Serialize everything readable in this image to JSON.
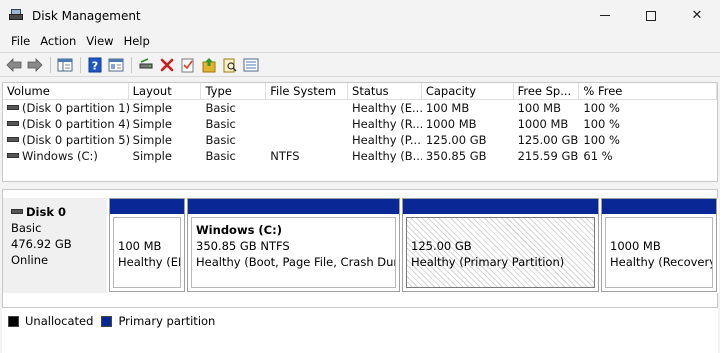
{
  "window": {
    "title": "Disk Management",
    "minimize": "—",
    "close": "✕"
  },
  "menu": [
    "File",
    "Action",
    "View",
    "Help"
  ],
  "toolbar": {
    "icons": [
      "back-arrow-icon",
      "forward-arrow-icon",
      "show-hide-console-tree-icon",
      "help-icon",
      "properties-icon",
      "connect-drive-icon",
      "delete-icon",
      "check-icon",
      "export-list-icon",
      "search-icon",
      "details-icon"
    ],
    "colors": {
      "delete": "#d11b1b",
      "help": "#1f57c6",
      "check": "#d8402a",
      "folder": "#e2b42a"
    }
  },
  "volumes": {
    "headers": [
      "Volume",
      "Layout",
      "Type",
      "File System",
      "Status",
      "Capacity",
      "Free Sp...",
      "% Free"
    ],
    "rows": [
      [
        "(Disk 0 partition 1)",
        "Simple",
        "Basic",
        "",
        "Healthy (E...",
        "100 MB",
        "100 MB",
        "100 %"
      ],
      [
        "(Disk 0 partition 4)",
        "Simple",
        "Basic",
        "",
        "Healthy (R...",
        "1000 MB",
        "1000 MB",
        "100 %"
      ],
      [
        "(Disk 0 partition 5)",
        "Simple",
        "Basic",
        "",
        "Healthy (P...",
        "125.00 GB",
        "125.00 GB",
        "100 %"
      ],
      [
        "Windows (C:)",
        "Simple",
        "Basic",
        "NTFS",
        "Healthy (B...",
        "350.85 GB",
        "215.59 GB",
        "61 %"
      ]
    ]
  },
  "disk": {
    "name": "Disk 0",
    "type": "Basic",
    "size": "476.92 GB",
    "status": "Online",
    "partitions": [
      {
        "name": "",
        "size": "100 MB",
        "status": "Healthy (EFI"
      },
      {
        "name": "Windows  (C:)",
        "size": "350.85 GB NTFS",
        "status": "Healthy (Boot, Page File, Crash Dump, E"
      },
      {
        "name": "",
        "size": "125.00 GB",
        "status": "Healthy (Primary Partition)"
      },
      {
        "name": "",
        "size": "1000 MB",
        "status": "Healthy (Recovery P"
      }
    ]
  },
  "legend": [
    {
      "label": "Unallocated",
      "color": "#000000"
    },
    {
      "label": "Primary partition",
      "color": "#0a2796"
    }
  ]
}
